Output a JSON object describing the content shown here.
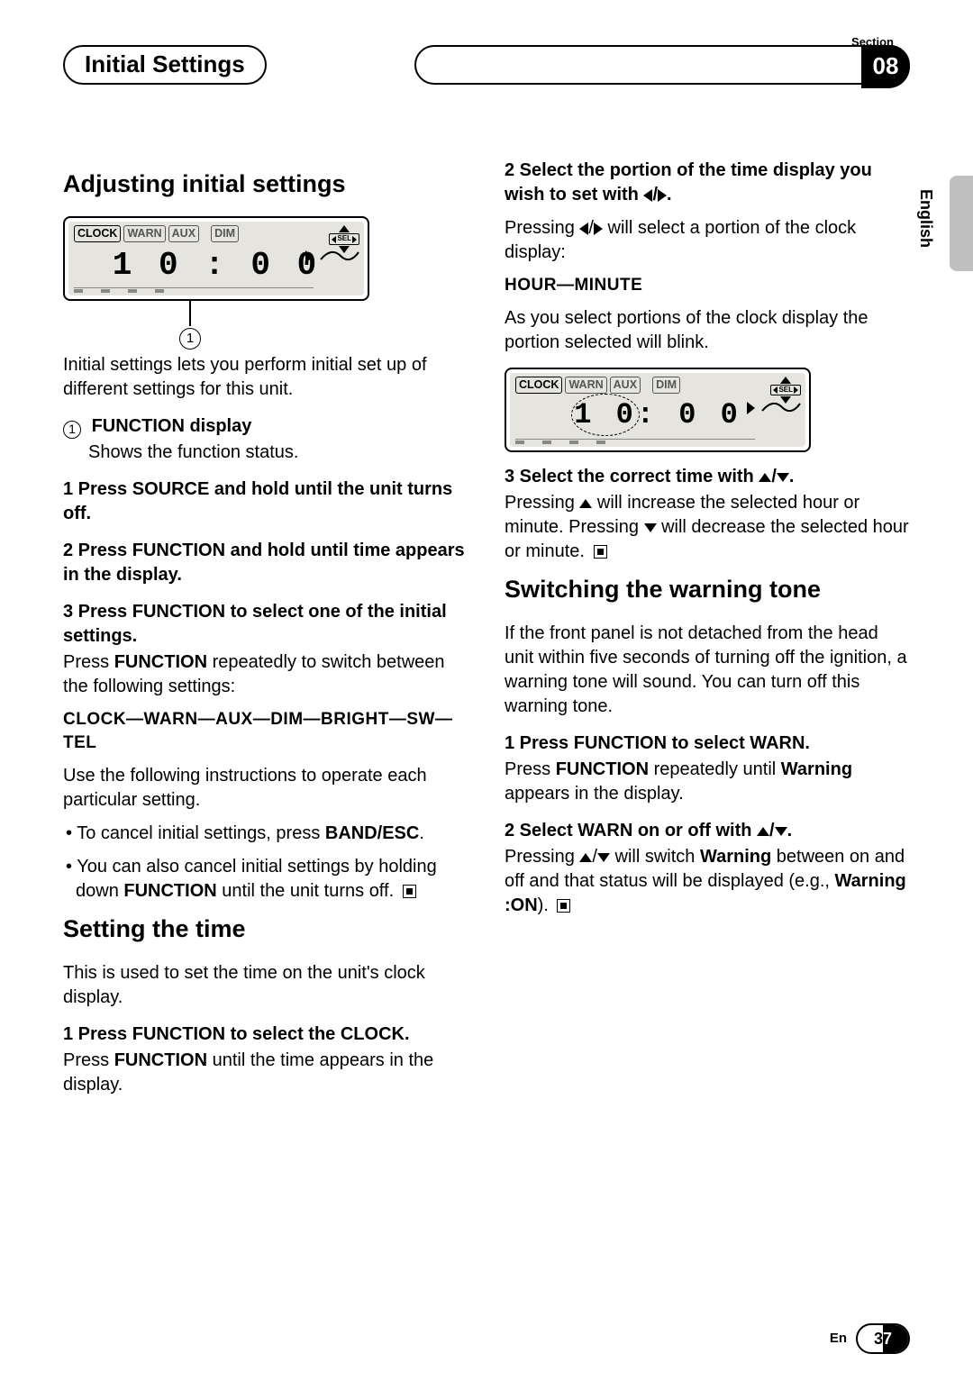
{
  "header": {
    "section_label": "Section",
    "title": "Initial Settings",
    "section_number": "08",
    "language_tab": "English"
  },
  "page_number": {
    "lang": "En",
    "num_left": "3",
    "num_right": "7"
  },
  "lcd": {
    "tags": [
      "CLOCK",
      "WARN",
      "AUX",
      "DIM"
    ],
    "sel": "SEL",
    "time1": "1 0 : 0 0",
    "time2_hr": "1 0",
    "time2_min": ": 0 0"
  },
  "left": {
    "h1": "Adjusting initial settings",
    "intro": "Initial settings lets you perform initial set up of different settings for this unit.",
    "callout_label": "1",
    "func_title": "FUNCTION display",
    "func_desc": "Shows the function status.",
    "step1": "1   Press SOURCE and hold until the unit turns off.",
    "step2": "2   Press FUNCTION and hold until time appears in the display.",
    "step3": "3   Press FUNCTION to select one of the initial settings.",
    "step3a_pre": "Press ",
    "step3a_bold": "FUNCTION",
    "step3a_post": " repeatedly to switch between the following settings:",
    "chain": "CLOCK—WARN—AUX—DIM—BRIGHT—SW—TEL",
    "use": "Use the following instructions to operate each particular setting.",
    "b1_pre": "• To cancel initial settings, press ",
    "b1_bold": "BAND/ESC",
    "b1_post": ".",
    "b2_pre": "• You can also cancel initial settings by holding down ",
    "b2_bold": "FUNCTION",
    "b2_post": " until the unit turns off.",
    "h2": "Setting the time",
    "set_intro": "This is used to set the time on the unit's clock display.",
    "set_step1": "1   Press FUNCTION to select the CLOCK.",
    "set_step1a_pre": "Press ",
    "set_step1a_bold": "FUNCTION",
    "set_step1a_post": " until the time appears in the display."
  },
  "right": {
    "step2_pre": "2   Select the portion of the time display you wish to set with ",
    "step2_post": ".",
    "step2a_pre": "Pressing ",
    "step2a_post": " will select a portion of the clock display:",
    "hm": "HOUR—MINUTE",
    "blink": "As you select portions of the clock display the portion selected will blink.",
    "step3_pre": "3   Select the correct time with ",
    "step3_post": ".",
    "step3a_pre": "Pressing ",
    "step3a_mid": " will increase the selected hour or minute. Pressing ",
    "step3a_post": " will decrease the selected hour or minute.",
    "h2": "Switching the warning tone",
    "warn_intro": "If the front panel is not detached from the head unit within five seconds of turning off the ignition, a warning tone will sound. You can turn off this warning tone.",
    "w1": "1   Press FUNCTION to select WARN.",
    "w1a_pre": "Press ",
    "w1a_b1": "FUNCTION",
    "w1a_mid": " repeatedly until ",
    "w1a_b2": "Warning",
    "w1a_post": " appears in the display.",
    "w2_pre": "2   Select WARN on or off with ",
    "w2_post": ".",
    "w2a_pre": "Pressing ",
    "w2a_mid": " will switch ",
    "w2a_b": "Warning",
    "w2a_post1": " between on and off and that status will be displayed (e.g., ",
    "w2a_b2": "Warning :ON",
    "w2a_post2": ")."
  }
}
